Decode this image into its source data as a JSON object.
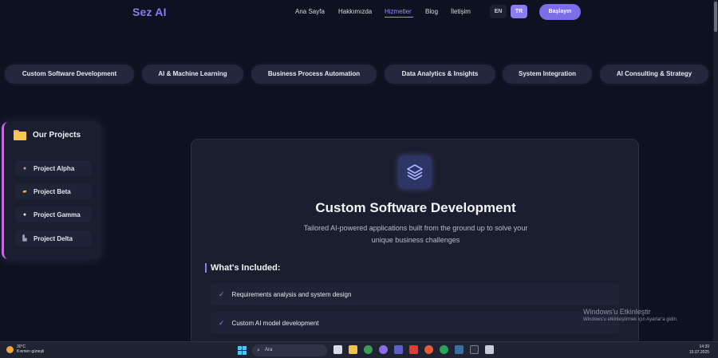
{
  "navbar": {
    "logo": "Sez AI",
    "links": [
      "Ana Sayfa",
      "Hakkımızda",
      "Hizmetler",
      "Blog",
      "İletişim"
    ],
    "active_link": "Hizmetler",
    "lang_en": "EN",
    "lang_tr": "TR",
    "cta_label": "Başlayın"
  },
  "services": [
    "Custom Software Development",
    "AI & Machine Learning",
    "Business Process Automation",
    "Data Analytics & Insights",
    "System Integration",
    "AI Consulting & Strategy"
  ],
  "projects": {
    "title": "Our Projects",
    "items": [
      {
        "icon": "brain-icon",
        "label": "Project Alpha"
      },
      {
        "icon": "truck-icon",
        "label": "Project Beta"
      },
      {
        "icon": "chat-icon",
        "label": "Project Gamma"
      },
      {
        "icon": "factory-icon",
        "label": "Project Delta"
      }
    ]
  },
  "detail": {
    "icon": "layers-icon",
    "title": "Custom Software Development",
    "description": "Tailored AI-powered applications built from the ground up to solve your unique business challenges",
    "included_heading": "What's Included:",
    "features": [
      "Requirements analysis and system design",
      "Custom AI model development"
    ]
  },
  "watermark": {
    "line1": "Windows'u Etkinleştir",
    "line2": "Windows'u etkinleştirmek için Ayarlar'a gidin."
  },
  "taskbar": {
    "weather_temp": "30°C",
    "weather_desc": "Kısmen güneşli",
    "search_placeholder": "Ara",
    "time": "14:39",
    "date": "15.07.2025"
  },
  "colors": {
    "background": "#0e1120",
    "accent": "#8c7cf0",
    "card": "#1b1e2e",
    "pill": "#23283d"
  }
}
